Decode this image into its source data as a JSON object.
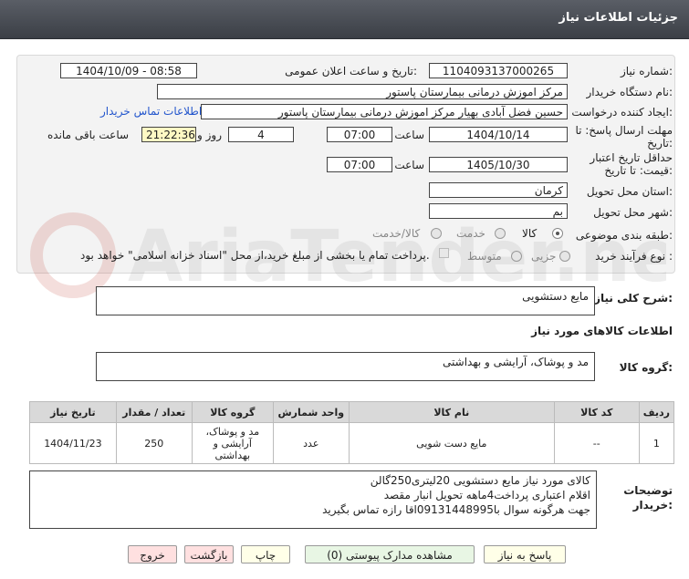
{
  "header": {
    "title": "جزئیات اطلاعات نیاز"
  },
  "form": {
    "need_number_label": "شماره نیاز:",
    "need_number": "1104093137000265",
    "announce_label": "تاریخ و ساعت اعلان عمومی:",
    "announce_value": "1404/10/09 - 08:58",
    "buyer_label": "نام دستگاه خریدار:",
    "buyer_value": "مرکز اموزش درمانی بیمارستان پاستور",
    "creator_label": "ایجاد کننده درخواست:",
    "creator_value": "حسین فضل آبادی بهیار مرکز اموزش درمانی بیمارستان پاستور",
    "contact_link": "اطلاعات تماس خریدار",
    "deadline_label": "مهلت ارسال پاسخ: تا تاریخ:",
    "deadline_date": "1404/10/14",
    "time_label": "ساعت",
    "deadline_time": "07:00",
    "days_value": "4",
    "days_label": "روز و",
    "remaining_time": "21:22:36",
    "remaining_label": "ساعت باقی مانده",
    "validity_label": "حداقل تاریخ اعتبار قیمت: تا تاریخ:",
    "validity_date": "1405/10/30",
    "validity_time": "07:00",
    "province_label": "استان محل تحویل:",
    "province_value": "کرمان",
    "city_label": "شهر محل تحویل:",
    "city_value": "بم",
    "category_label": "طبقه بندی موضوعی:",
    "category_options": [
      "کالا",
      "خدمت",
      "کالا/خدمت"
    ],
    "category_selected": "کالا",
    "process_label": "نوع فرآیند خرید :",
    "process_options": [
      "جزیی",
      "متوسط"
    ],
    "process_selected": "جزیی",
    "payment_note": "پرداخت تمام یا بخشی از مبلغ خرید،از محل \"اسناد خزانه اسلامی\" خواهد بود."
  },
  "summary": {
    "label": "شرح کلی نیاز:",
    "value": "مایع دستشویی"
  },
  "goods": {
    "section_title": "اطلاعات کالاهای مورد نیاز",
    "group_label": "گروه کالا:",
    "group_value": "مد و پوشاک، آرایشی و بهداشتی"
  },
  "table": {
    "headers": [
      "ردیف",
      "کد کالا",
      "نام کالا",
      "واحد شمارش",
      "گروه کالا",
      "تعداد / مقدار",
      "تاریخ نیاز"
    ],
    "rows": [
      [
        "1",
        "--",
        "مایع دست شویی",
        "عدد",
        "مد و پوشاک، آرایشی و بهداشتی",
        "250",
        "1404/11/23"
      ]
    ]
  },
  "notes": {
    "label": "توضیحات خریدار:",
    "lines": [
      "کالای مورد نیاز مایع دستشویی 20لیتری250گالن",
      "اقلام اعتباری پرداخت4ماهه تحویل انبار مقصد",
      "جهت هرگونه سوال با09131448995اقا رازه تماس بگیرید"
    ]
  },
  "buttons": {
    "reply": "پاسخ به نیاز",
    "docs": "مشاهده مدارک پیوستی (0)",
    "print": "چاپ",
    "back": "بازگشت",
    "exit": "خروج"
  },
  "watermark": {
    "text": "AriaTender.neT"
  },
  "colors": {
    "header_bg": "#4a4e55",
    "link": "#2255cc",
    "remaining_bg": "#fff9c4"
  }
}
